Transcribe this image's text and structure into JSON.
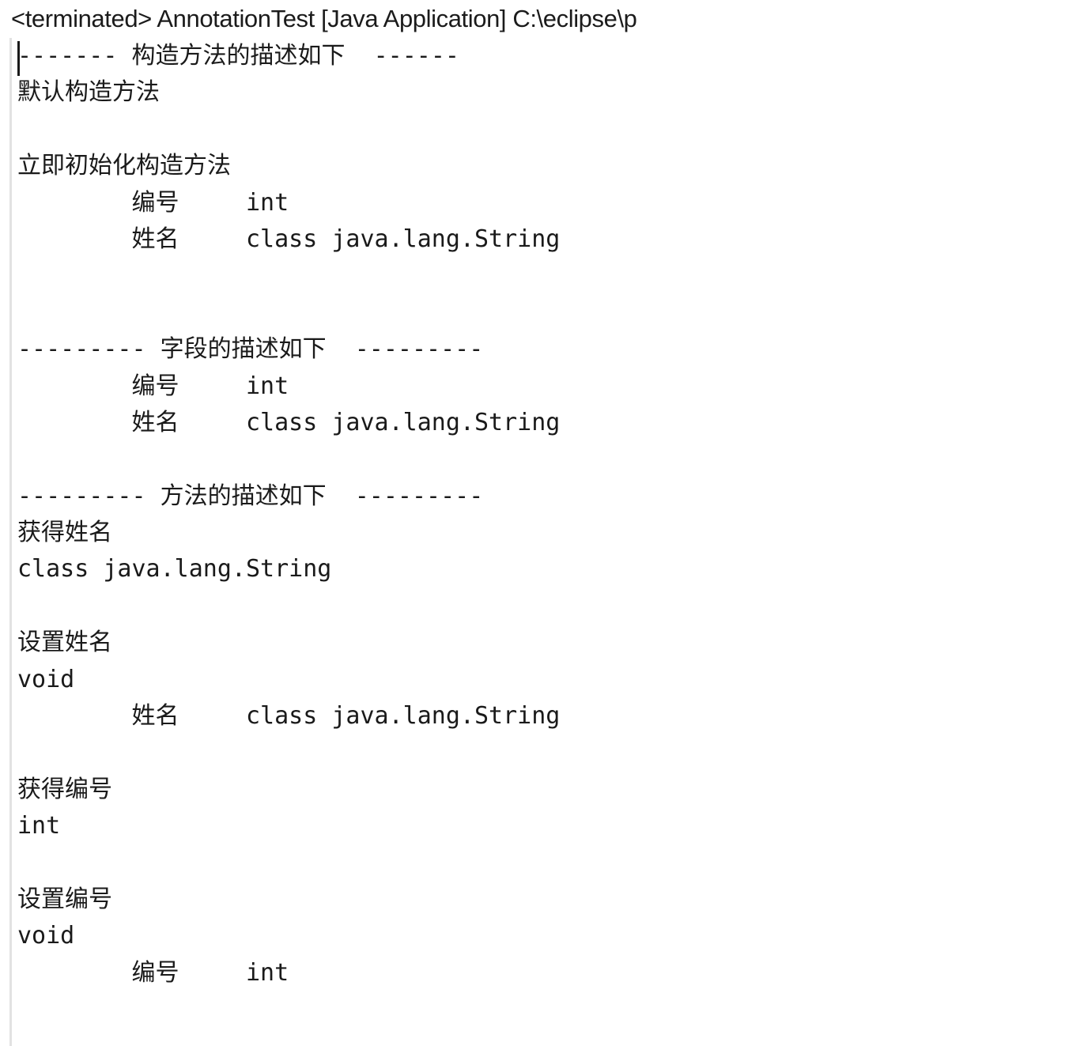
{
  "window": {
    "view_name": "Console",
    "title": "<terminated> AnnotationTest [Java Application] C:\\eclipse\\p",
    "title_truncated": true
  },
  "console": {
    "status": "terminated",
    "launch_name": "AnnotationTest",
    "launch_type": "Java Application",
    "jre_path_partial": "C:\\eclipse\\p",
    "caret_present": true,
    "lines": [
      "------- 构造方法的描述如下  ------",
      "默认构造方法",
      "",
      "立即初始化构造方法",
      "\t编号\tint",
      "\t姓名\tclass java.lang.String",
      "",
      "",
      "--------- 字段的描述如下  ---------",
      "\t编号\tint",
      "\t姓名\tclass java.lang.String",
      "",
      "--------- 方法的描述如下  ---------",
      "获得姓名",
      "class java.lang.String",
      "",
      "设置姓名",
      "void",
      "\t姓名\tclass java.lang.String",
      "",
      "获得编号",
      "int",
      "",
      "设置编号",
      "void",
      "\t编号\tint",
      ""
    ],
    "sections": [
      {
        "header": "------- 构造方法的描述如下  ------",
        "title": "构造方法的描述如下",
        "entries": [
          {
            "name": "默认构造方法",
            "params": []
          },
          {
            "name": "立即初始化构造方法",
            "params": [
              {
                "label": "编号",
                "type": "int"
              },
              {
                "label": "姓名",
                "type": "class java.lang.String"
              }
            ]
          }
        ]
      },
      {
        "header": "--------- 字段的描述如下  ---------",
        "title": "字段的描述如下",
        "entries": [
          {
            "name": "",
            "params": [
              {
                "label": "编号",
                "type": "int"
              },
              {
                "label": "姓名",
                "type": "class java.lang.String"
              }
            ]
          }
        ]
      },
      {
        "header": "--------- 方法的描述如下  ---------",
        "title": "方法的描述如下",
        "entries": [
          {
            "name": "获得姓名",
            "returns": "class java.lang.String",
            "params": []
          },
          {
            "name": "设置姓名",
            "returns": "void",
            "params": [
              {
                "label": "姓名",
                "type": "class java.lang.String"
              }
            ]
          },
          {
            "name": "获得编号",
            "returns": "int",
            "params": []
          },
          {
            "name": "设置编号",
            "returns": "void",
            "params": [
              {
                "label": "编号",
                "type": "int"
              }
            ]
          }
        ]
      }
    ]
  },
  "colors": {
    "background": "#ffffff",
    "text": "#1a1a1a",
    "title_text": "#1b1b1b",
    "border": "#c8c8c8",
    "left_rule": "#e2e2e2"
  }
}
